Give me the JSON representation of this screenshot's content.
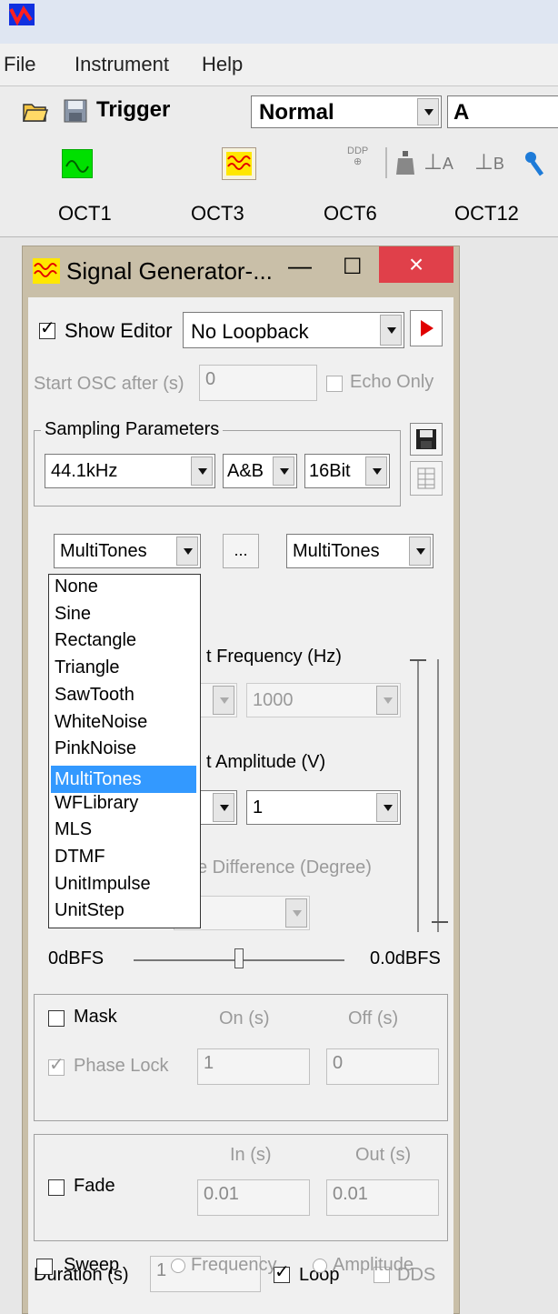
{
  "menu": {
    "file": "File",
    "instrument": "Instrument",
    "help": "Help"
  },
  "toolbar": {
    "trigger_label": "Trigger",
    "trigger_mode": "Normal",
    "channel": "A",
    "ddp_label": "DDP",
    "marker_a": "A",
    "marker_b": "B"
  },
  "octaves": [
    "OCT1",
    "OCT3",
    "OCT6",
    "OCT12"
  ],
  "window": {
    "title": "Signal Generator-...",
    "minimize": "—",
    "maximize": "☐",
    "close": "×"
  },
  "editor": {
    "show_editor_label": "Show Editor",
    "show_editor_checked": true,
    "loopback_value": "No Loopback",
    "start_osc_label": "Start OSC after (s)",
    "start_osc_value": "0",
    "echo_only_label": "Echo Only"
  },
  "sampling": {
    "group_label": "Sampling Parameters",
    "rate": "44.1kHz",
    "channels": "A&B",
    "bits": "16Bit"
  },
  "waveform": {
    "selected": "MultiTones",
    "more_button": "...",
    "second_select": "MultiTones",
    "options": [
      "None",
      "Sine",
      "Rectangle",
      "Triangle",
      "SawTooth",
      "WhiteNoise",
      "PinkNoise",
      "MultiTones",
      "WFLibrary",
      "MLS",
      "DTMF",
      "UnitImpulse",
      "UnitStep"
    ],
    "selected_index": 7
  },
  "params": {
    "frequency_label": "t Frequency (Hz)",
    "frequency_value": "1000",
    "amplitude_label": "t Amplitude (V)",
    "amplitude_value": "1",
    "phase_label": "e Difference (Degree)"
  },
  "level": {
    "left": "0dBFS",
    "right": "0.0dBFS",
    "level_fraction": 0.5
  },
  "mask": {
    "label": "Mask",
    "on_label": "On (s)",
    "off_label": "Off (s)",
    "phase_lock_label": "Phase Lock",
    "on_value": "1",
    "off_value": "0"
  },
  "fade": {
    "label": "Fade",
    "in_label": "In (s)",
    "out_label": "Out (s)",
    "in_value": "0.01",
    "out_value": "0.01"
  },
  "duration": {
    "label": "Duration (s)",
    "value": "1",
    "loop_label": "Loop",
    "loop_checked": true,
    "dds_label": "DDS"
  },
  "sweep": {
    "label": "Sweep",
    "frequency_label": "Frequency",
    "amplitude_label": "Amplitude"
  },
  "colors": {
    "accent_red": "#e81123",
    "list_highlight": "#3399ff",
    "play_red": "#e00000"
  }
}
